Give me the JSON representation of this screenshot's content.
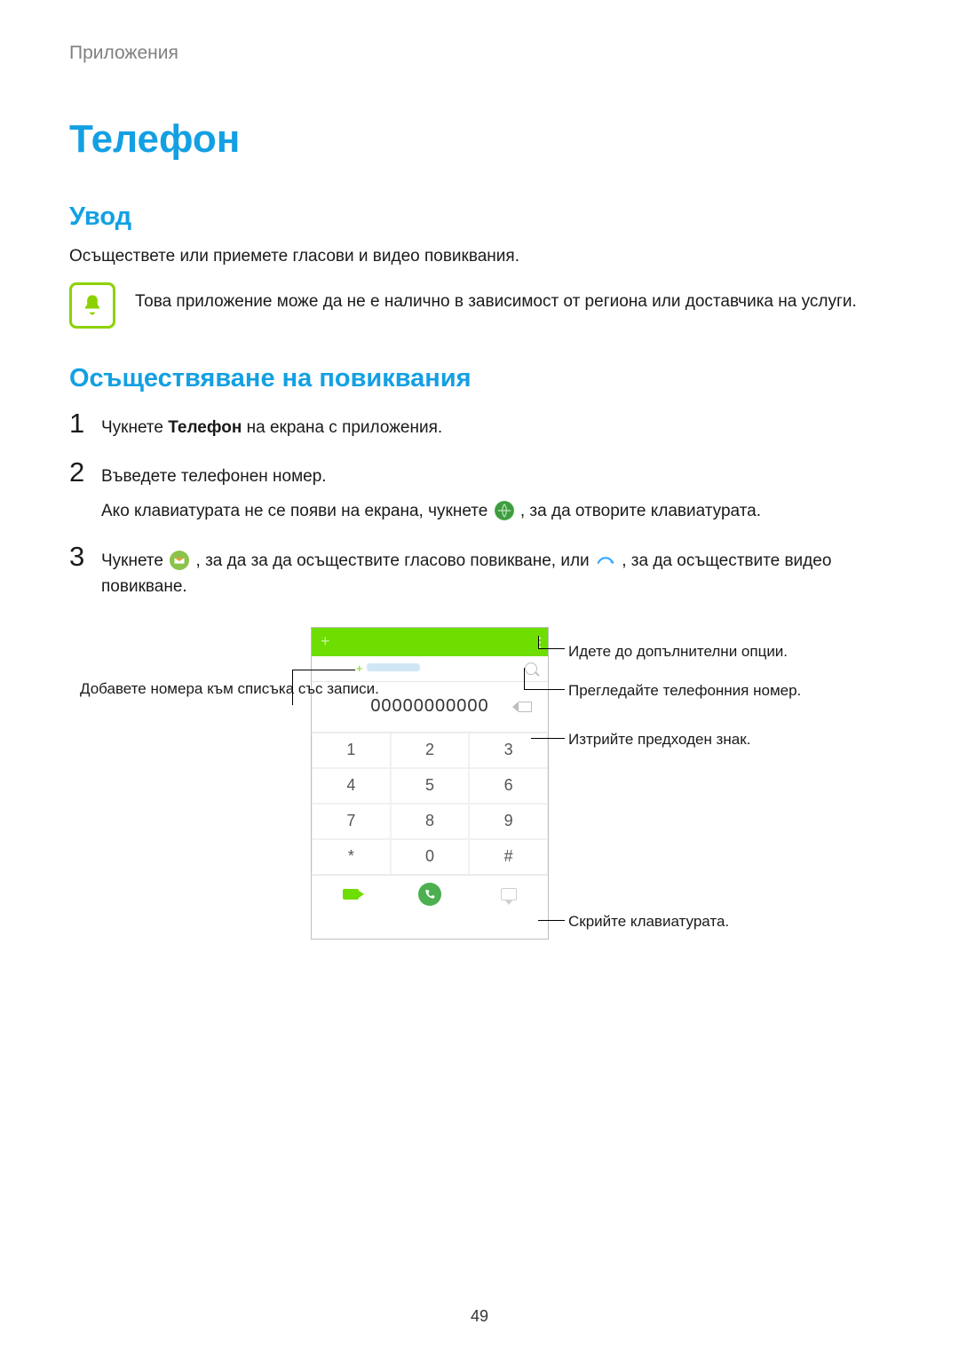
{
  "breadcrumb": "Приложения",
  "h1": "Телефон",
  "intro_h2": "Увод",
  "intro_p": "Осъществете или приемете гласови и видео повиквания.",
  "note": "Това приложение може да не е налично в зависимост от региона или доставчика на услуги.",
  "calls_h2": "Осъществяване на повиквания",
  "steps": {
    "s1_num": "1",
    "s1_pre": "Чукнете ",
    "s1_bold": "Телефон",
    "s1_post": " на екрана с приложения.",
    "s2_num": "2",
    "s2_line1": "Въведете телефонен номер.",
    "s2_line2_pre": "Ако клавиатурата не се появи на екрана, чукнете ",
    "s2_line2_post": ", за да отворите клавиатурата.",
    "s3_num": "3",
    "s3_pre": "Чукнете ",
    "s3_mid": ", за да за да осъществите гласово повикване, или ",
    "s3_post": ", за да осъществите видео повикване."
  },
  "figure": {
    "number": "00000000000",
    "keys": [
      [
        "1",
        "2",
        "3"
      ],
      [
        "4",
        "5",
        "6"
      ],
      [
        "7",
        "8",
        "9"
      ],
      [
        "*",
        "0",
        "#"
      ]
    ],
    "label_left": "Добавете номера към списъка със записи.",
    "label_r1": "Идете до допълнителни опции.",
    "label_r2": "Прегледайте телефонния номер.",
    "label_r3": "Изтрийте предходен знак.",
    "label_r4": "Скрийте клавиатурата."
  },
  "page_number": "49"
}
